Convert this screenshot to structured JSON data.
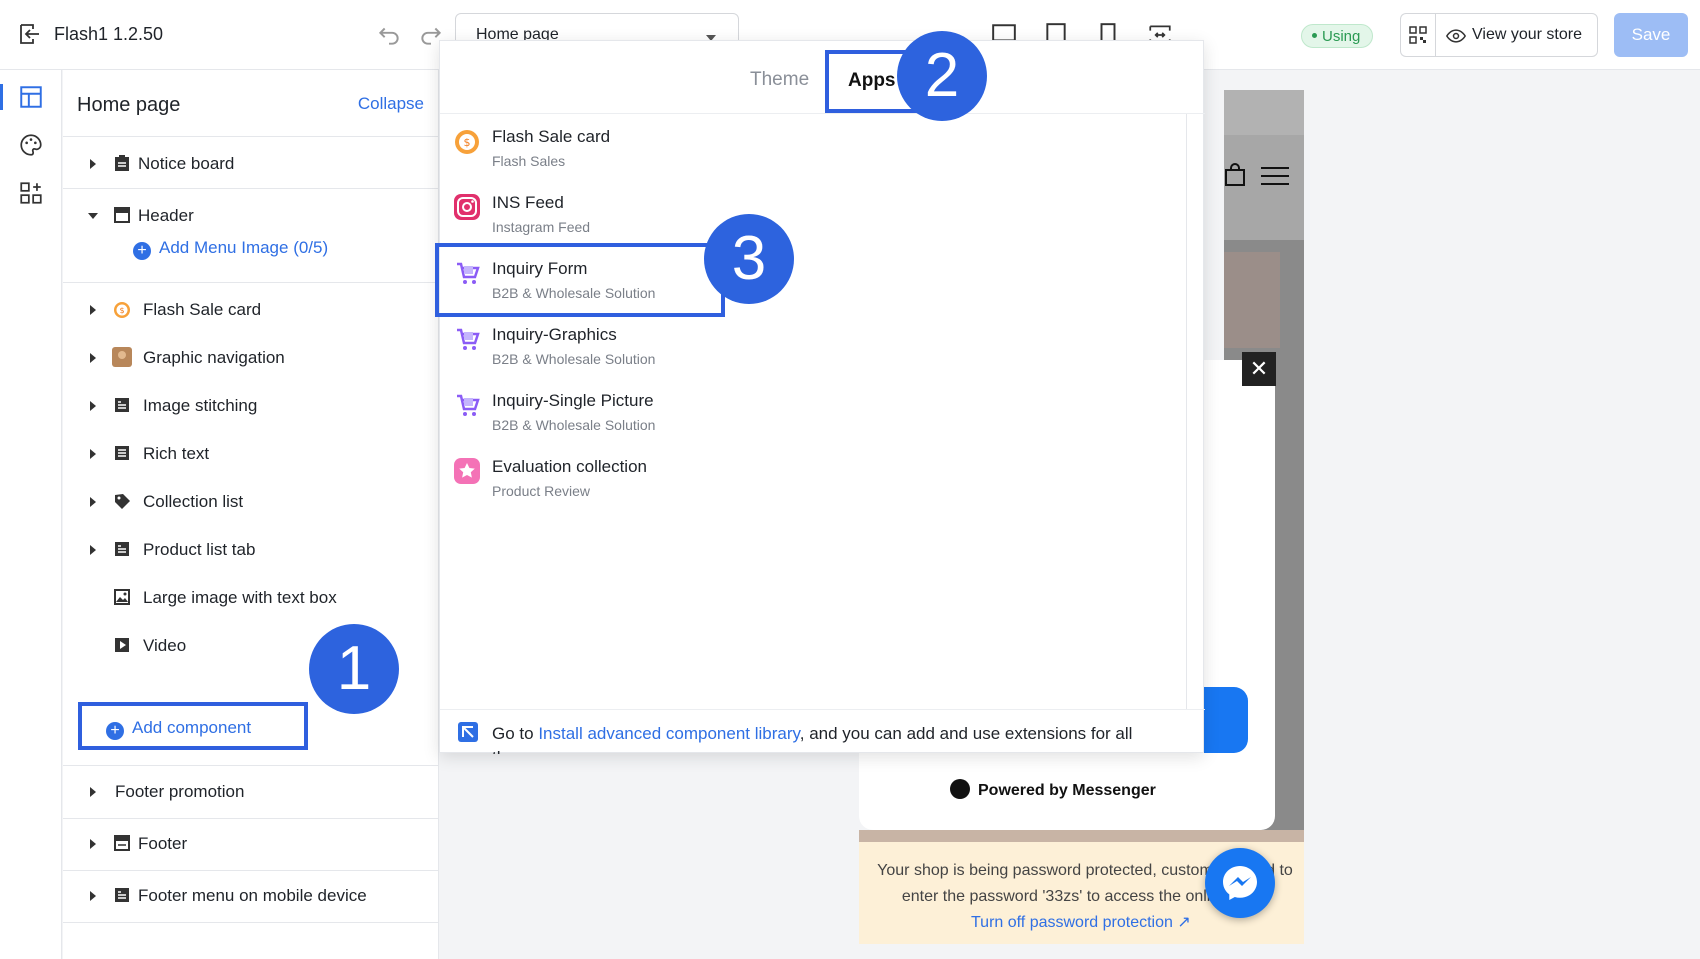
{
  "topbar": {
    "app_title": "Flash1  1.2.50",
    "page_select": "Home page",
    "using_badge": "Using",
    "view_store": "View your store",
    "save": "Save"
  },
  "sidebar": {
    "title": "Home page",
    "collapse": "Collapse",
    "items": [
      {
        "label": "Notice board",
        "icon": "clipboard-icon"
      },
      {
        "label": "Header",
        "icon": "header-icon"
      },
      {
        "label": "Flash Sale card",
        "icon": "flash-sale-icon"
      },
      {
        "label": "Graphic navigation",
        "icon": "image-thumb-icon"
      },
      {
        "label": "Image stitching",
        "icon": "layout-icon"
      },
      {
        "label": "Rich text",
        "icon": "text-icon"
      },
      {
        "label": "Collection list",
        "icon": "tag-icon"
      },
      {
        "label": "Product list tab",
        "icon": "layout-icon"
      },
      {
        "label": "Large image with text box",
        "icon": "image-icon"
      },
      {
        "label": "Video",
        "icon": "play-icon"
      },
      {
        "label": "Footer promotion",
        "icon": ""
      },
      {
        "label": "Footer",
        "icon": "footer-icon"
      },
      {
        "label": "Footer menu on mobile device",
        "icon": "layout-icon"
      }
    ],
    "add_menu_image": "Add Menu Image (0/5)",
    "add_component": "Add component"
  },
  "dropdown": {
    "tab_theme": "Theme",
    "tab_apps": "Apps",
    "apps": [
      {
        "name": "Flash Sale card",
        "sub": "Flash Sales",
        "icon": "flash-sale-icon"
      },
      {
        "name": "INS Feed",
        "sub": "Instagram Feed",
        "icon": "instagram-icon"
      },
      {
        "name": "Inquiry Form",
        "sub": "B2B & Wholesale Solution",
        "icon": "cart-icon"
      },
      {
        "name": "Inquiry-Graphics",
        "sub": "B2B & Wholesale Solution",
        "icon": "cart-icon"
      },
      {
        "name": "Inquiry-Single Picture",
        "sub": "B2B & Wholesale Solution",
        "icon": "cart-icon"
      },
      {
        "name": "Evaluation collection",
        "sub": "Product Review",
        "icon": "review-icon"
      }
    ],
    "footer_prefix": "Go to ",
    "footer_link": "Install advanced component library",
    "footer_suffix": ", and you can add and use extensions for all themes"
  },
  "badges": {
    "one": "1",
    "two": "2",
    "three": "3"
  },
  "preview": {
    "powered_by": "Powered by Messenger",
    "password_text": "Your shop is being password protected, customers need to enter the password '33zs' to access the online store",
    "turn_off": "Turn off password protection"
  },
  "colors": {
    "accent": "#2f6fe4",
    "highlight_border": "#2f5fde",
    "badge": "#2d63de",
    "save_disabled": "#9dbdf5"
  }
}
